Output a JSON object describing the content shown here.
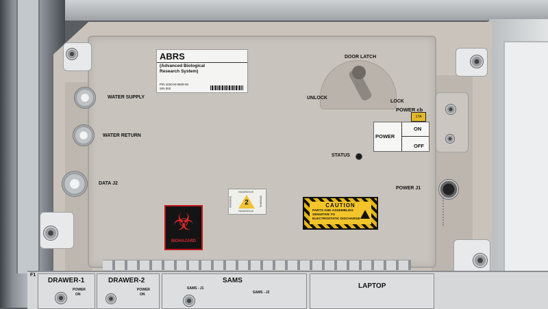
{
  "panel": {
    "label": {
      "title": "ABRS",
      "subtitle": "(Advanced Biological Research System)",
      "part_number": "P/N 1020-M-0509-00",
      "serial_number": "S/N 002"
    },
    "door_latch": "DOOR LATCH",
    "unlock": "UNLOCK",
    "lock": "LOCK",
    "water_supply": "WATER SUPPLY",
    "water_return": "WATER RETURN",
    "data_j2": "DATA J2",
    "status": "STATUS",
    "power_cb": "POWER cb",
    "power_cb_rating": "17A",
    "power": "POWER",
    "on": "ON",
    "off": "OFF",
    "power_j1": "POWER J1"
  },
  "hazard_2": {
    "number": "2",
    "top_text": "HAZARDOUS",
    "bottom_text": "HAZARDOUS",
    "side_left": "MATERIAL",
    "side_right": "MATERIAL"
  },
  "biohazard": {
    "text": "BIOHAZARD",
    "glyph": "☣"
  },
  "caution": {
    "title": "CAUTION",
    "body": "PARTS AND ASSEMBLIES SENSITIVE TO ELECTROSTATIC DISCHARGE"
  },
  "bottom": {
    "f1": "F1",
    "drawer1": "DRAWER-1",
    "drawer2": "DRAWER-2",
    "power_label": "POWER",
    "power_on": "ON",
    "sams": "SAMS",
    "sams_j1": "SAMS - J1",
    "sams_j2": "SAMS - J2",
    "laptop": "LAPTOP"
  },
  "colors": {
    "panel": "#c8c3bc",
    "caution_yellow": "#e4b61b",
    "biohazard_red": "#c2161b",
    "label_white": "#f4f4f2"
  },
  "icons": [
    "biohazard-icon",
    "esd-warning-icon",
    "hazard-triangle-icon"
  ]
}
